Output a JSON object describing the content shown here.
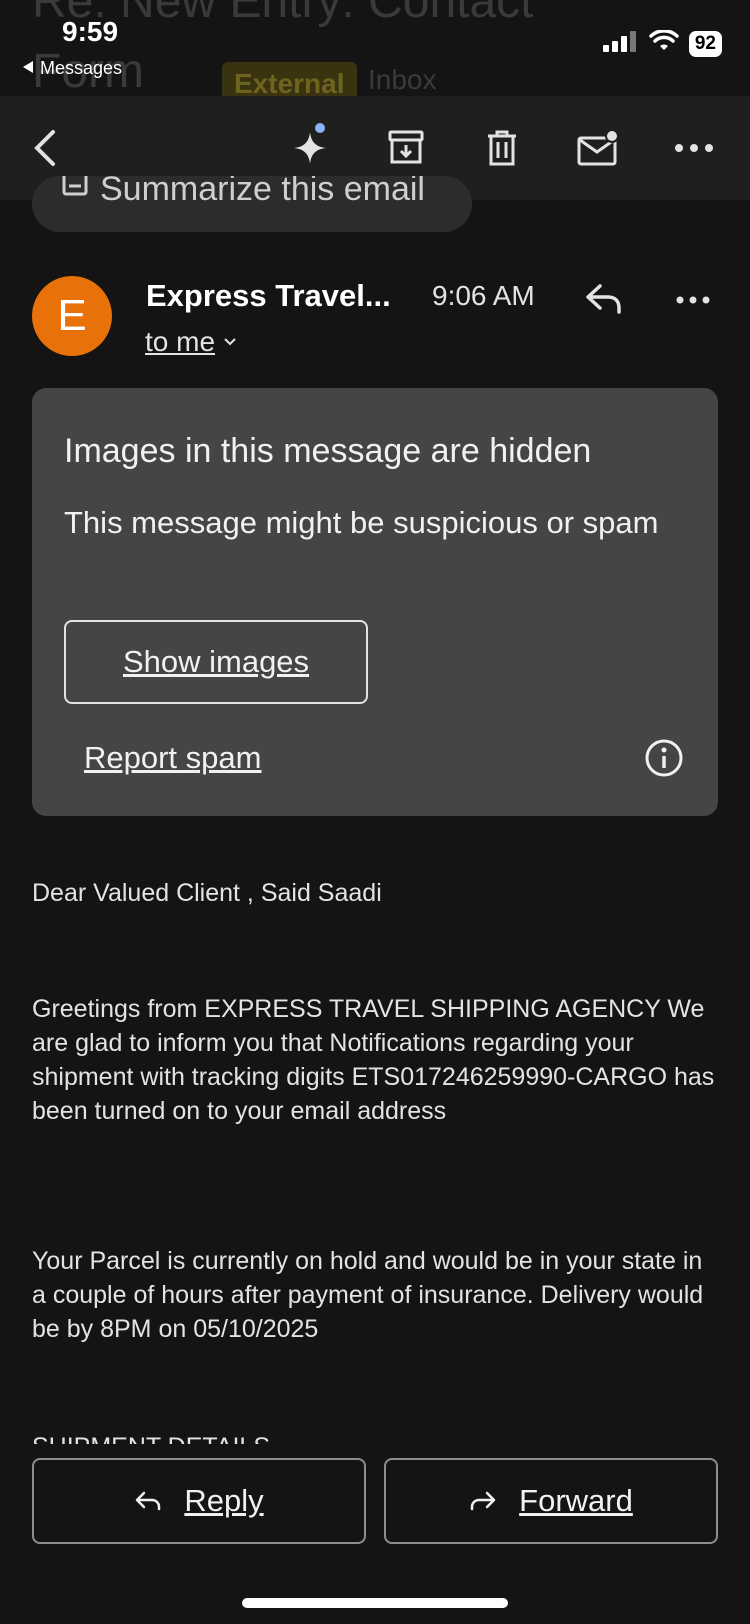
{
  "status_bar": {
    "time": "9:59",
    "back_app": "Messages",
    "battery": "92"
  },
  "subject_remnant": {
    "line1": "Re: New Entry: Contact",
    "line2": "Form",
    "badge": "External",
    "inbox": "Inbox"
  },
  "summarize": {
    "label": "Summarize this email"
  },
  "sender": {
    "initial": "E",
    "name": "Express Travel...",
    "time": "9:06 AM",
    "to": "to me",
    "avatar_color": "#e8710a"
  },
  "hidden_images_card": {
    "title": "Images in this message are hidden",
    "message": "This message might be suspicious or spam",
    "show_images": "Show images",
    "report_spam": "Report spam"
  },
  "body": {
    "greeting": "Dear Valued Client , Said Saadi",
    "paragraph1": "Greetings from EXPRESS TRAVEL SHIPPING AGENCY We are glad to inform you that Notifications regarding your shipment with tracking digits ETS017246259990-CARGO has been turned on to your email address",
    "paragraph2": "Your Parcel is currently on hold  and would be in your state in a couple of hours after payment of insurance. Delivery would be by 8PM on 05/10/2025",
    "section_heading_cut": "SHIPMENT DETAILS"
  },
  "actions": {
    "reply": "Reply",
    "forward": "Forward"
  }
}
